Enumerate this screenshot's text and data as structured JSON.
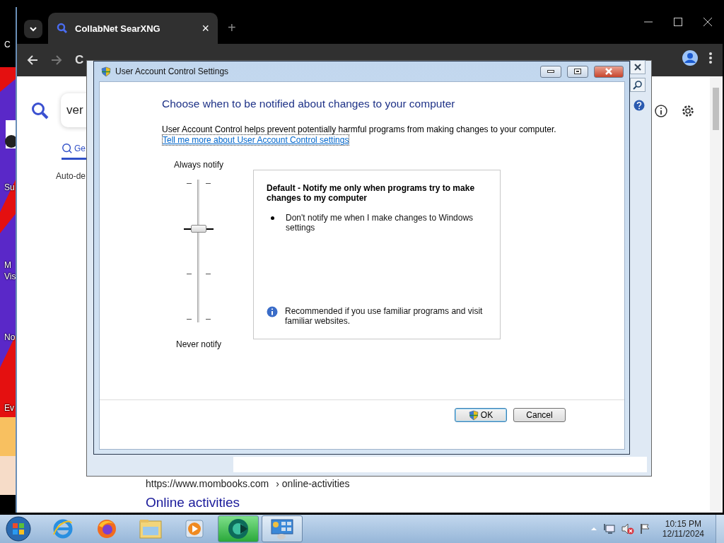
{
  "desktop": {
    "icon_labels": [
      "C",
      "Su",
      "M",
      "Vis",
      "No",
      "Ev"
    ]
  },
  "browser": {
    "tab": {
      "title": "CollabNet SearXNG",
      "close": "×"
    },
    "new_tab": "+",
    "toolbar_partial": "C",
    "search_value": "ver",
    "category_tab": "Ge",
    "setting_text": "Auto-de",
    "result_url": "https://www.mombooks.com",
    "result_path": "› online-activities",
    "result_title": "Online activities"
  },
  "dialog": {
    "title": "User Account Control Settings",
    "heading": "Choose when to be notified about changes to your computer",
    "description": "User Account Control helps prevent potentially harmful programs from making changes to your computer.",
    "link": "Tell me more about User Account Control settings",
    "slider": {
      "top_label": "Always notify",
      "bottom_label": "Never notify",
      "level": 0.667
    },
    "box": {
      "title": "Default - Notify me only when programs try to make changes to my computer",
      "bullets": [
        "Don't notify me when I make changes to Windows settings"
      ],
      "note": "Recommended if you use familiar programs and visit familiar websites."
    },
    "buttons": [
      {
        "label": "OK",
        "shield": true,
        "default": true
      },
      {
        "label": "Cancel",
        "shield": false,
        "default": false
      }
    ]
  },
  "taskbar": {
    "apps": [
      {
        "kind": "ie",
        "running": false
      },
      {
        "kind": "firefox",
        "running": false
      },
      {
        "kind": "explorer",
        "running": false
      },
      {
        "kind": "media",
        "running": false
      },
      {
        "kind": "app",
        "running": true
      },
      {
        "kind": "control",
        "running": true
      }
    ],
    "clock": {
      "time": "10:15 PM",
      "date": "12/11/2024"
    }
  }
}
